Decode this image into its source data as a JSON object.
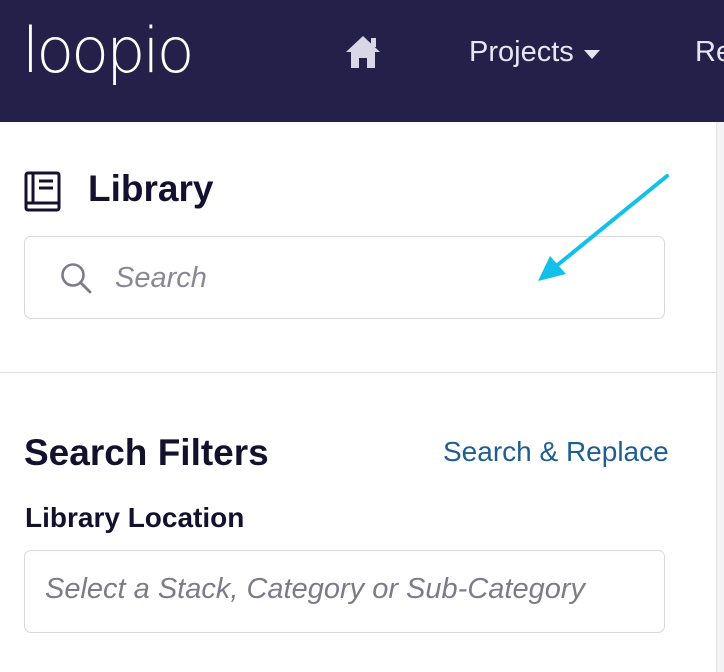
{
  "app": {
    "logo_text": "loopio",
    "brand_color": "#25204a"
  },
  "nav": {
    "home_icon": "home-icon",
    "projects_label": "Projects",
    "next_item_partial": "Re"
  },
  "library": {
    "title": "Library",
    "icon": "book-icon",
    "search": {
      "placeholder": "Search",
      "value": ""
    }
  },
  "filters": {
    "title": "Search Filters",
    "replace_link": "Search & Replace",
    "location_label": "Library Location",
    "location_placeholder": "Select a Stack, Category or Sub-Category"
  },
  "annotation": {
    "arrow_color": "#12c1ea"
  }
}
